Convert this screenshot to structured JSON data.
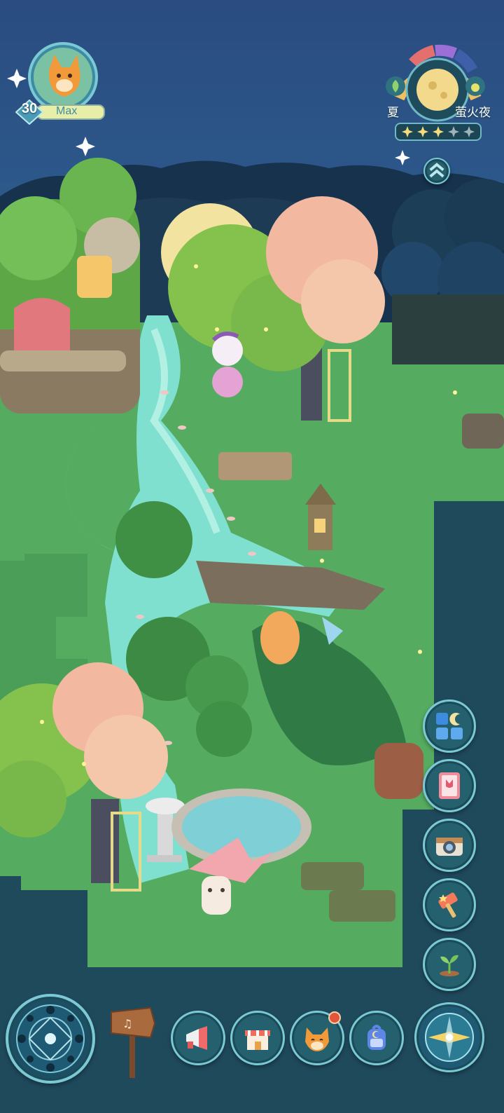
{
  "player": {
    "level": "30",
    "name": "Max"
  },
  "season": {
    "season_label": "夏",
    "event_label": "萤火夜",
    "stars_filled": 3,
    "stars_total": 5
  },
  "right_menu": [
    {
      "name": "collection-button",
      "icon": "moon-grid-icon"
    },
    {
      "name": "guide-book-button",
      "icon": "tulip-book-icon"
    },
    {
      "name": "camera-button",
      "icon": "camera-icon"
    },
    {
      "name": "build-hammer-button",
      "icon": "star-hammer-icon"
    },
    {
      "name": "planting-button",
      "icon": "sprout-icon"
    }
  ],
  "bottom_bar": [
    {
      "name": "compass-map-button",
      "icon": "moon-phase-dial-icon"
    },
    {
      "name": "music-sign-button",
      "icon": "signpost-icon"
    },
    {
      "name": "announcement-button",
      "icon": "megaphone-icon"
    },
    {
      "name": "shop-button",
      "icon": "store-icon"
    },
    {
      "name": "friends-button",
      "icon": "fox-face-icon",
      "notification": true
    },
    {
      "name": "backpack-button",
      "icon": "backpack-icon"
    },
    {
      "name": "navigate-button",
      "icon": "compass-needle-icon"
    }
  ],
  "colors": {
    "sky": "#2b4f83",
    "grass": "#5bb063",
    "water": "#7fe0cf",
    "hud_teal": "#24606e",
    "hud_border": "#7cc9d6"
  }
}
